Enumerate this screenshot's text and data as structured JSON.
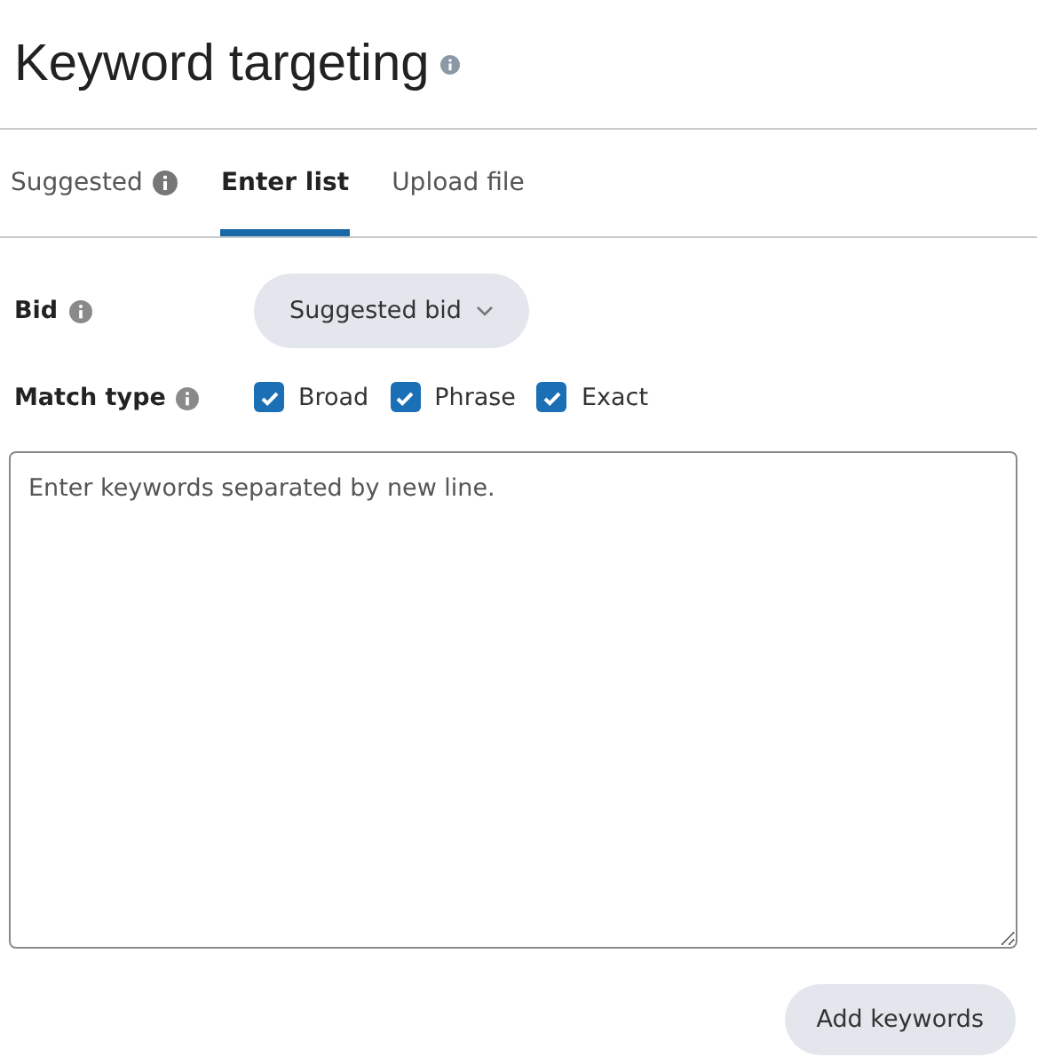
{
  "title": "Keyword targeting",
  "tabs": [
    {
      "label": "Suggested",
      "selected": false,
      "info": true
    },
    {
      "label": "Enter list",
      "selected": true,
      "info": false
    },
    {
      "label": "Upload file",
      "selected": false,
      "info": false
    }
  ],
  "bid": {
    "label": "Bid",
    "value": "Suggested bid"
  },
  "match_type": {
    "label": "Match type",
    "options": [
      {
        "label": "Broad",
        "checked": true
      },
      {
        "label": "Phrase",
        "checked": true
      },
      {
        "label": "Exact",
        "checked": true
      }
    ]
  },
  "keywords": {
    "placeholder": "Enter keywords separated by new line."
  },
  "add_button": "Add keywords"
}
